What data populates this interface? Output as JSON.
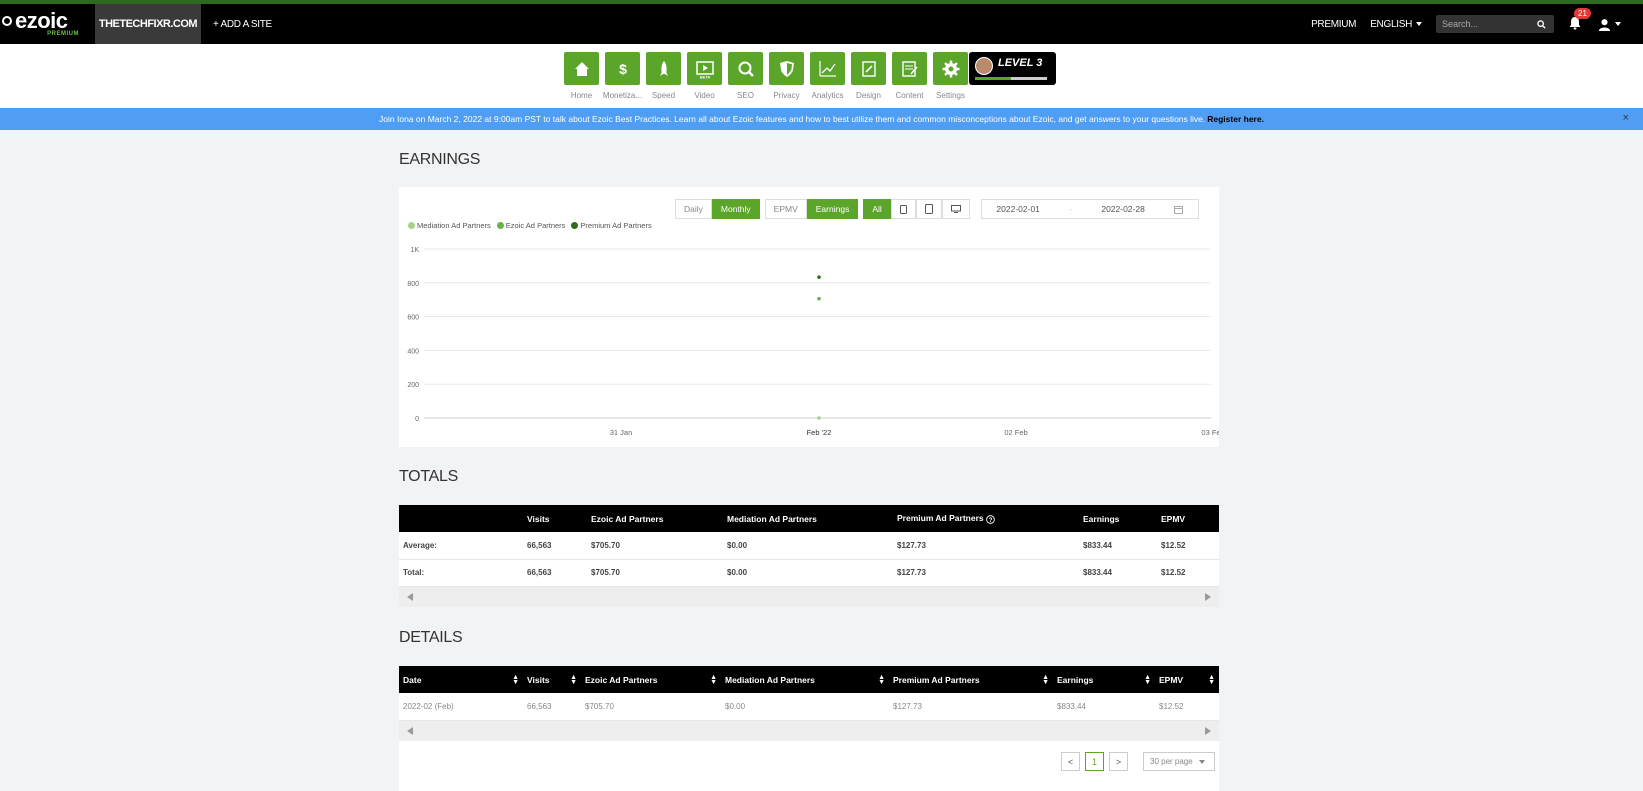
{
  "brand": {
    "logo": "ezoic",
    "tier": "PREMIUM"
  },
  "topbar": {
    "site": "THETECHFIXR.COM",
    "add_site": "+ ADD A SITE",
    "premium": "PREMIUM",
    "language": "ENGLISH",
    "search_placeholder": "Search...",
    "notification_count": "21"
  },
  "toolbar": {
    "items": [
      {
        "label": "Home",
        "icon": "home-icon"
      },
      {
        "label": "Monetiza...",
        "icon": "dollar-icon"
      },
      {
        "label": "Speed",
        "icon": "rocket-icon"
      },
      {
        "label": "Video",
        "icon": "video-icon"
      },
      {
        "label": "SEO",
        "icon": "magnifier-icon"
      },
      {
        "label": "Privacy",
        "icon": "shield-icon"
      },
      {
        "label": "Analytics",
        "icon": "line-chart-icon"
      },
      {
        "label": "Design",
        "icon": "design-icon"
      },
      {
        "label": "Content",
        "icon": "content-icon"
      },
      {
        "label": "Settings",
        "icon": "gear-icon"
      }
    ],
    "video_tag": "BETA",
    "level": "LEVEL 3",
    "level_progress": 0.5
  },
  "announcement": {
    "text": "Join Iona on March 2, 2022 at 9:00am PST to talk about Ezoic Best Practices. Learn all about Ezoic features and how to best utilize them and common misconceptions about Ezoic, and get answers to your questions live.",
    "link": "Register here.",
    "close": "×"
  },
  "earnings": {
    "title": "EARNINGS",
    "period_buttons": [
      "Daily",
      "Monthly"
    ],
    "metric_buttons": [
      "EPMV",
      "Earnings"
    ],
    "device_buttons": [
      "All"
    ],
    "date_start": "2022-02-01",
    "date_sep": "-",
    "date_end": "2022-02-28"
  },
  "chart_data": {
    "type": "scatter",
    "legend": [
      {
        "name": "Mediation Ad Partners",
        "color": "#a8d08d"
      },
      {
        "name": "Ezoic Ad Partners",
        "color": "#6ab04c"
      },
      {
        "name": "Premium Ad Partners",
        "color": "#2f6b1c"
      }
    ],
    "y_ticks": [
      "0",
      "200",
      "400",
      "600",
      "800",
      "1K"
    ],
    "ylim": [
      0,
      1000
    ],
    "x_ticks": [
      "31 Jan",
      "Feb '22",
      "02 Feb",
      "03 Fe"
    ],
    "series": [
      {
        "name": "Mediation Ad Partners",
        "x": "Feb '22",
        "y": 0,
        "color": "#a8d08d"
      },
      {
        "name": "Ezoic Ad Partners",
        "x": "Feb '22",
        "y": 705.7,
        "color": "#6ab04c"
      },
      {
        "name": "Premium Ad Partners",
        "x": "Feb '22",
        "y": 833.44,
        "color": "#2f6b1c"
      }
    ],
    "grid": true,
    "legend_position": "top-left"
  },
  "totals": {
    "title": "TOTALS",
    "headers": [
      "",
      "Visits",
      "Ezoic Ad Partners",
      "Mediation Ad Partners",
      "Premium Ad Partners",
      "Earnings",
      "EPMV"
    ],
    "rows": [
      [
        "Average:",
        "66,563",
        "$705.70",
        "$0.00",
        "$127.73",
        "$833.44",
        "$12.52"
      ],
      [
        "Total:",
        "66,563",
        "$705.70",
        "$0.00",
        "$127.73",
        "$833.44",
        "$12.52"
      ]
    ]
  },
  "details": {
    "title": "DETAILS",
    "headers": [
      "Date",
      "Visits",
      "Ezoic Ad Partners",
      "Mediation Ad Partners",
      "Premium Ad Partners",
      "Earnings",
      "EPMV"
    ],
    "rows": [
      [
        "2022-02 (Feb)",
        "66,563",
        "$705.70",
        "$0.00",
        "$127.73",
        "$833.44",
        "$12.52"
      ]
    ],
    "pager": {
      "prev": "<",
      "page": "1",
      "next": ">",
      "per_page": "30 per page"
    }
  }
}
